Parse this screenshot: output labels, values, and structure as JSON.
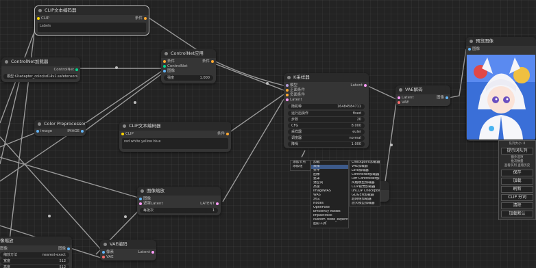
{
  "colors": {
    "clip": "#ffd500",
    "conditioning": "#ffa931",
    "image": "#64b5f6",
    "latent": "#ff9cf9",
    "vae": "#ff6e6e",
    "model": "#b39ddb",
    "control": "#00d78d",
    "wire": "#9a9a9a"
  },
  "nodes": {
    "clip_top": {
      "title": "CLIP文本编码器",
      "in_clip": "CLIP",
      "out": "条件",
      "text": "Labels"
    },
    "controlnet_loader": {
      "title": "ControlNet加载器",
      "out": "ControlNet",
      "value": "模型:t2iadapter_color/sd14v1.safetensors"
    },
    "controlnet_apply": {
      "title": "ControlNet应用",
      "in1": "条件",
      "in2": "ControlNet",
      "in3": "图像",
      "out": "条件",
      "w_label": "强度",
      "w_value": "1.000"
    },
    "ksampler": {
      "title": "K采样器",
      "in1": "模型",
      "in2": "正面条件",
      "in3": "负面条件",
      "in4": "Latent",
      "out": "Latent",
      "rows": [
        [
          "随机种",
          "16484584711"
        ],
        [
          "运行后操作",
          "fixed"
        ],
        [
          "步数",
          "20"
        ],
        [
          "CFG",
          "8.000"
        ],
        [
          "采样器",
          "euler"
        ],
        [
          "调度器",
          "normal"
        ],
        [
          "降噪",
          "1.000"
        ]
      ]
    },
    "vae_decode": {
      "title": "VAE解码",
      "in1": "Latent",
      "in2": "VAE",
      "out": "图像"
    },
    "preview": {
      "title": "预览图像",
      "in1": "图像"
    },
    "color_pre": {
      "title": "Color Preprocessor",
      "in1": "image",
      "out": "IMAGE"
    },
    "clip_mid": {
      "title": "CLIP文本编码器",
      "in_clip": "CLIP",
      "out": "条件",
      "text": "red white yellow blue"
    },
    "image_scale": {
      "title": "图像缩放",
      "in1": "图像",
      "in2": "遮罩Latent",
      "out": "LATENT",
      "w_label": "每批次",
      "w_value": "1"
    },
    "vae_encode": {
      "title": "VAE编码",
      "in1": "像素",
      "in2": "VAE",
      "out": "Latent"
    },
    "left_node": {
      "title": "像缩放",
      "in1": "图像",
      "out": "图像",
      "rows": [
        [
          "缩放方法",
          "nearest-exact"
        ],
        [
          "宽度",
          "512"
        ],
        [
          "高度",
          "512"
        ]
      ]
    }
  },
  "menu_left": [
    "添加节点",
    "添加组"
  ],
  "menu_mid": [
    "加载",
    "采样",
    "条件",
    "图像",
    "遮罩",
    "潜空间",
    "高级",
    "ImageWAS",
    "WAS",
    "测试",
    "Nodes",
    "OpenPose",
    "Efficiency Nodes",
    "ImpactPack",
    "custom_node_experiments",
    "图形工具"
  ],
  "menu_right": [
    "Checkpoint加载器",
    "VAE加载器",
    "Lora加载器",
    "ControlNet加载器",
    "Diff ControlNet加载器",
    "风格模型加载器",
    "CLIP视觉加载器",
    "unCLIP Checkpoint加载器",
    "GLIGEN加载器",
    "超网络加载器",
    "放大模型加载器"
  ],
  "panel": {
    "queue_size": "队列大小: 0",
    "buttons": [
      "提示词队列",
      "保存",
      "加载",
      "刷新",
      "CLIP 分词",
      "清除",
      "加载默认"
    ],
    "extra": "额外选项",
    "batch": "批次数量",
    "view_queue": "查看队列",
    "view_history": "查看历史"
  }
}
